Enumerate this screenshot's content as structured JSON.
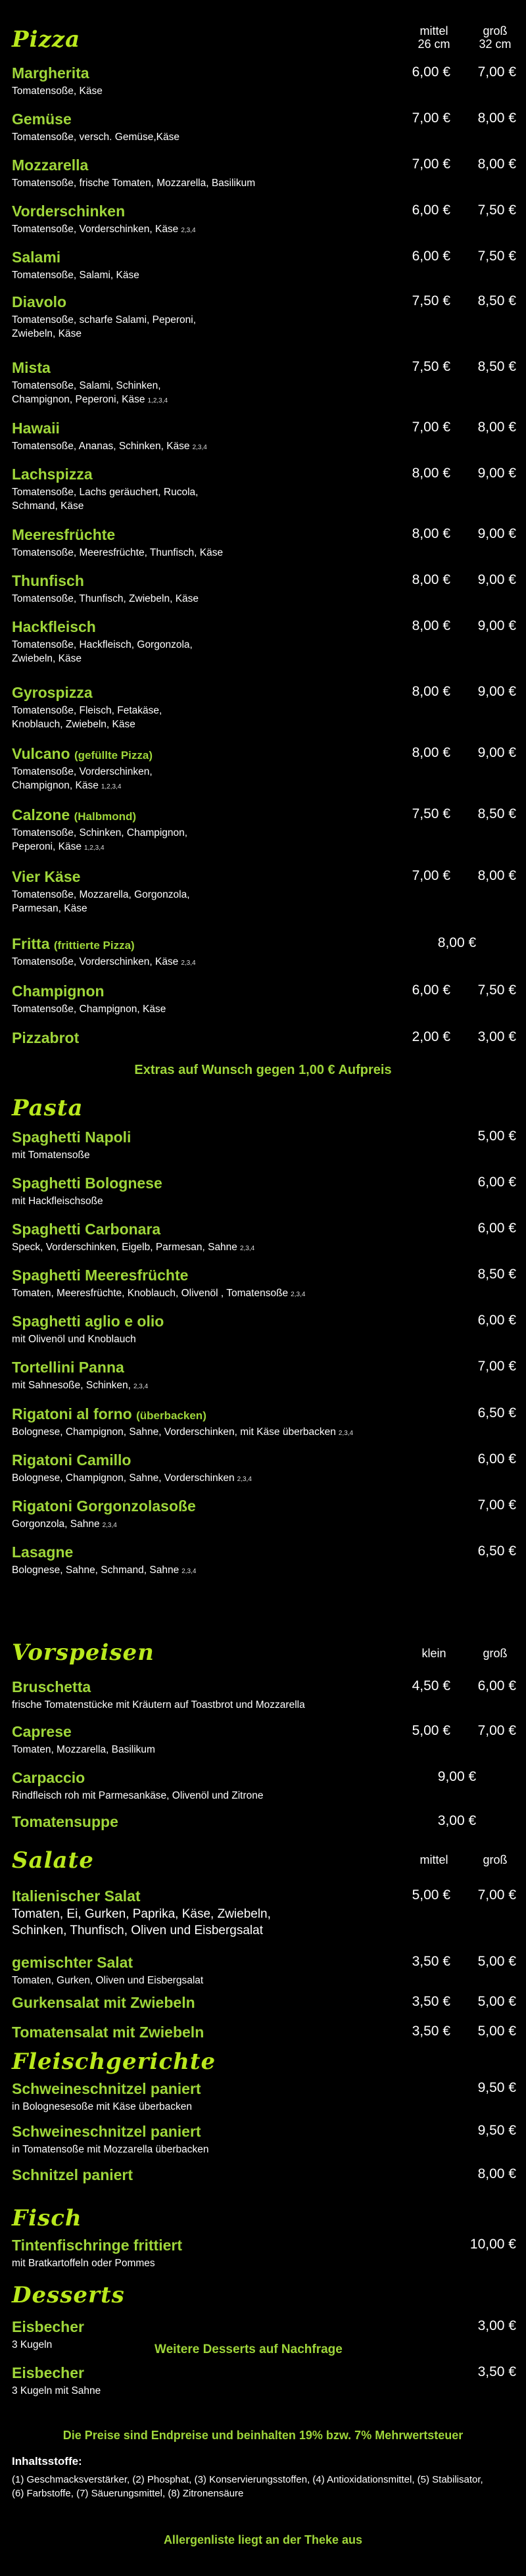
{
  "pizza": {
    "title": "Pizza",
    "col1": "mittel\n26 cm",
    "col2": "groß\n32 cm",
    "items": [
      {
        "name": "Margherita",
        "desc": "Tomatensoße, Käse",
        "note": "",
        "p1": "6,00 €",
        "p2": "7,00 €"
      },
      {
        "name": "Gemüse",
        "desc": "Tomatensoße, versch. Gemüse,Käse",
        "note": "",
        "p1": "7,00 €",
        "p2": "8,00 €"
      },
      {
        "name": "Mozzarella",
        "desc": "Tomatensoße, frische Tomaten, Mozzarella, Basilikum",
        "note": "",
        "p1": "7,00 €",
        "p2": "8,00 €"
      },
      {
        "name": "Vorderschinken",
        "desc": "Tomatensoße, Vorderschinken, Käse",
        "note": "2,3,4",
        "p1": "6,00 €",
        "p2": "7,50 €"
      },
      {
        "name": "Salami",
        "desc": "Tomatensoße, Salami, Käse",
        "note": "",
        "p1": "6,00 €",
        "p2": "7,50 €"
      },
      {
        "name": "Diavolo",
        "desc": "Tomatensoße, scharfe Salami, Peperoni,\nZwiebeln, Käse",
        "note": "",
        "p1": "7,50 €",
        "p2": "8,50 €"
      },
      {
        "name": "Mista",
        "desc": "Tomatensoße, Salami, Schinken,\nChampignon, Peperoni, Käse",
        "note": "1,2,3,4",
        "p1": "7,50 €",
        "p2": "8,50 €"
      },
      {
        "name": "Hawaii",
        "desc": "Tomatensoße, Ananas, Schinken, Käse",
        "note": "2,3,4",
        "p1": "7,00 €",
        "p2": "8,00 €"
      },
      {
        "name": "Lachspizza",
        "desc": "Tomatensoße, Lachs geräuchert, Rucola,\nSchmand, Käse",
        "note": "",
        "p1": "8,00 €",
        "p2": "9,00 €"
      },
      {
        "name": "Meeresfrüchte",
        "desc": "Tomatensoße, Meeresfrüchte, Thunfisch, Käse",
        "note": "",
        "p1": "8,00 €",
        "p2": "9,00 €"
      },
      {
        "name": "Thunfisch",
        "desc": "Tomatensoße, Thunfisch, Zwiebeln, Käse",
        "note": "",
        "p1": "8,00 €",
        "p2": "9,00 €"
      },
      {
        "name": "Hackfleisch",
        "desc": "Tomatensoße, Hackfleisch, Gorgonzola,\nZwiebeln, Käse",
        "note": "",
        "p1": "8,00 €",
        "p2": "9,00 €"
      },
      {
        "name": "Gyrospizza",
        "desc": "Tomatensoße, Fleisch, Fetakäse,\nKnoblauch, Zwiebeln, Käse",
        "note": "",
        "p1": "8,00 €",
        "p2": "9,00 €"
      },
      {
        "name": "Vulcano",
        "sub": "(gefüllte Pizza)",
        "desc": "Tomatensoße, Vorderschinken,\nChampignon, Käse",
        "note": "1,2,3,4",
        "p1": "8,00 €",
        "p2": "9,00 €"
      },
      {
        "name": "Calzone",
        "sub": "(Halbmond)",
        "desc": "Tomatensoße, Schinken, Champignon,\nPeperoni, Käse",
        "note": "1,2,3,4",
        "p1": "7,50 €",
        "p2": "8,50 €"
      },
      {
        "name": "Vier Käse",
        "desc": "Tomatensoße, Mozzarella, Gorgonzola,\nParmesan, Käse",
        "note": "",
        "p1": "7,00 €",
        "p2": "8,00 €"
      },
      {
        "name": "Fritta",
        "sub": "(frittierte Pizza)",
        "desc": "Tomatensoße, Vorderschinken, Käse",
        "note": "2,3,4",
        "pc": "8,00 €"
      },
      {
        "name": "Champignon",
        "desc": "Tomatensoße, Champignon, Käse",
        "note": "",
        "p1": "6,00 €",
        "p2": "7,50 €"
      },
      {
        "name": "Pizzabrot",
        "desc": "",
        "note": "",
        "p1": "2,00 €",
        "p2": "3,00 €"
      }
    ],
    "extras": "Extras auf Wunsch gegen 1,00 € Aufpreis"
  },
  "pasta": {
    "title": "Pasta",
    "items": [
      {
        "name": "Spaghetti Napoli",
        "desc": "mit Tomatensoße",
        "note": "",
        "p": "5,00 €"
      },
      {
        "name": "Spaghetti Bolognese",
        "desc": "mit Hackfleischsoße",
        "note": "",
        "p": "6,00 €"
      },
      {
        "name": "Spaghetti Carbonara",
        "desc": "Speck, Vorderschinken, Eigelb, Parmesan, Sahne",
        "note": "2,3,4",
        "p": "6,00 €"
      },
      {
        "name": "Spaghetti Meeresfrüchte",
        "desc": "Tomaten, Meeresfrüchte, Knoblauch, Olivenöl ,  Tomatensoße",
        "note": "2,3,4",
        "p": "8,50 €"
      },
      {
        "name": "Spaghetti aglio e olio",
        "desc": "mit Olivenöl und Knoblauch",
        "note": "",
        "p": "6,00 €"
      },
      {
        "name": "Tortellini Panna",
        "desc": "mit Sahnesoße, Schinken,",
        "note": "2,3,4",
        "p": "7,00 €"
      },
      {
        "name": "Rigatoni al forno",
        "sub": "(überbacken)",
        "desc": "Bolognese, Champignon, Sahne, Vorderschinken, mit Käse überbacken",
        "note": "2,3,4",
        "p": "6,50 €"
      },
      {
        "name": "Rigatoni Camillo",
        "desc": "Bolognese, Champignon, Sahne, Vorderschinken",
        "note": "2,3,4",
        "p": "6,00 €"
      },
      {
        "name": "Rigatoni Gorgonzolasoße",
        "desc": "Gorgonzola, Sahne",
        "note": "2,3,4",
        "p": "7,00 €"
      },
      {
        "name": "Lasagne",
        "desc": "Bolognese, Sahne, Schmand, Sahne",
        "note": "2,3,4",
        "p": "6,50 €"
      }
    ]
  },
  "vorspeisen": {
    "title": "Vorspeisen",
    "col1": "klein",
    "col2": "groß",
    "items": [
      {
        "name": "Bruschetta",
        "desc": "frische Tomatenstücke mit Kräutern auf Toastbrot und Mozzarella",
        "p1": "4,50 €",
        "p2": "6,00 €"
      },
      {
        "name": "Caprese",
        "desc": "Tomaten, Mozzarella, Basilikum",
        "p1": "5,00 €",
        "p2": "7,00 €"
      },
      {
        "name": "Carpaccio",
        "desc": "Rindfleisch roh mit Parmesankäse, Olivenöl und Zitrone",
        "pc": "9,00 €"
      },
      {
        "name": "Tomatensuppe",
        "desc": "",
        "pc": "3,00 €"
      }
    ]
  },
  "salate": {
    "title": "Salate",
    "col1": "mittel",
    "col2": "groß",
    "items": [
      {
        "name": "Italienischer Salat",
        "desc": "Tomaten, Ei, Gurken, Paprika, Käse, Zwiebeln,\nSchinken, Thunfisch, Oliven und Eisbergsalat",
        "p1": "5,00 €",
        "p2": "7,00 €"
      },
      {
        "name": "gemischter Salat",
        "desc": "Tomaten, Gurken, Oliven und Eisbergsalat",
        "p1": "3,50 €",
        "p2": "5,00 €"
      },
      {
        "name": "Gurkensalat mit Zwiebeln",
        "desc": "",
        "p1": "3,50 €",
        "p2": "5,00 €"
      },
      {
        "name": "Tomatensalat mit Zwiebeln",
        "desc": "",
        "p1": "3,50 €",
        "p2": "5,00 €"
      }
    ]
  },
  "fleisch": {
    "title": "Fleischgerichte",
    "items": [
      {
        "name": "Schweineschnitzel paniert",
        "desc": "in Bolognesesoße mit Käse überbacken",
        "p": "9,50 €"
      },
      {
        "name": "Schweineschnitzel paniert",
        "desc": "in Tomatensoße mit Mozzarella überbacken",
        "p": "9,50 €"
      },
      {
        "name": "Schnitzel paniert",
        "desc": "",
        "p": "8,00 €"
      }
    ]
  },
  "fisch": {
    "title": "Fisch",
    "items": [
      {
        "name": "Tintenfischringe frittiert",
        "desc": "mit Bratkartoffeln oder Pommes",
        "p": "10,00 €"
      }
    ]
  },
  "desserts": {
    "title": "Desserts",
    "items": [
      {
        "name": "Eisbecher",
        "desc": "3 Kugeln",
        "p": "3,00 €"
      },
      {
        "name": "Eisbecher",
        "desc": "3 Kugeln mit Sahne",
        "p": "3,50 €"
      }
    ],
    "more": "Weitere Desserts auf Nachfrage"
  },
  "footer": {
    "prices": "Die Preise sind Endpreise und beinhalten 19% bzw. 7% Mehrwertsteuer",
    "additives_title": "Inhaltsstoffe:",
    "additives": "(1) Geschmacksverstärker, (2) Phosphat, (3) Konservierungsstoffen, (4) Antioxidationsmittel, (5) Stabilisator,\n(6) Farbstoffe, (7) Säuerungsmittel, (8) Zitronensäure",
    "allergens": "Allergenliste liegt an der Theke aus"
  },
  "colors": {
    "background": "#000000",
    "heading": "#b9e81d",
    "name": "#9fd63a",
    "text": "#ffffff"
  }
}
